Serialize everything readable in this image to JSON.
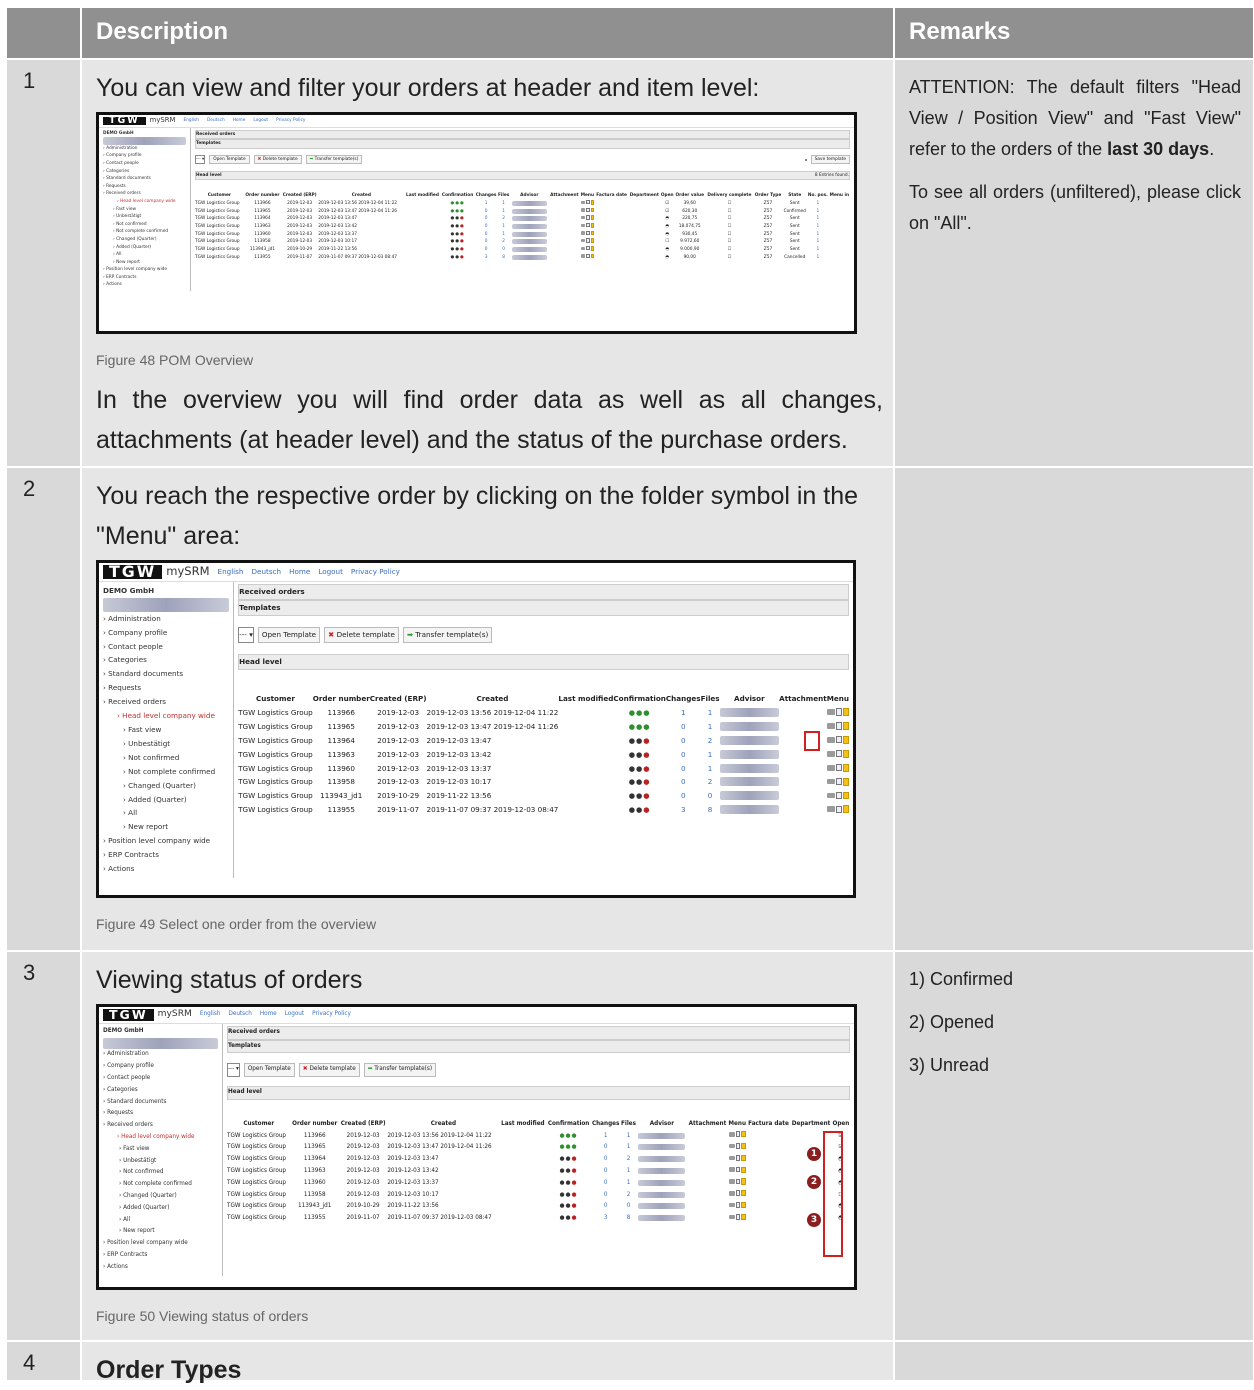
{
  "header": {
    "description": "Description",
    "remarks": "Remarks"
  },
  "rows": [
    {
      "num": "1",
      "lead": "You can view and filter your orders at header and item level:",
      "caption": "Figure 48 POM Overview",
      "para": "In the overview you will find order data as well as all changes, attachments (at header level) and the status of the purchase orders.",
      "remarks": {
        "p1": "ATTENTION: The default filters \"Head View / Position View\" and \"Fast View\" refer to the orders of the ",
        "p1_bold": "last 30 days",
        "p1_end": ".",
        "p2": "To see all orders (unfiltered), please click on \"All\"."
      }
    },
    {
      "num": "2",
      "lead": "You reach the respective order by clicking on the folder symbol in the \"Menu\" area:",
      "caption": "Figure 49 Select one order from the overview"
    },
    {
      "num": "3",
      "lead": "Viewing status of orders",
      "caption": "Figure 50 Viewing status of orders",
      "remarks": [
        "1) Confirmed",
        "2) Opened",
        "3) Unread"
      ]
    },
    {
      "num": "4",
      "lead": "Order Types"
    }
  ],
  "app": {
    "logo": "TGW",
    "brand": "mySRM",
    "links": [
      "English",
      "Deutsch",
      "Home",
      "Logout",
      "Privacy Policy"
    ],
    "company": "DEMO GmbH",
    "nav": [
      "Administration",
      "Company profile",
      "Contact people",
      "Categories",
      "Standard documents",
      "Requests",
      "Received orders"
    ],
    "nav_active": "Head level company wide",
    "nav_sub": [
      "Fast view",
      "Unbestätigt",
      "Not confirmed",
      "Not complete confirmed",
      "Changed (Quarter)",
      "Added (Quarter)",
      "All",
      "New report"
    ],
    "nav_tail": [
      "Position level company wide",
      "ERP Contracts",
      "Actions"
    ],
    "panel_title": "Received orders",
    "templates_title": "Templates",
    "select_value": "---",
    "btn_open": "Open Template",
    "btn_delete": "Delete template",
    "btn_transfer": "Transfer template(s)",
    "btn_save": "Save template",
    "head_level": "Head level",
    "entries_found": "8 Entries found.",
    "columns": [
      "Customer",
      "Order number",
      "Created (ERP)",
      "Created",
      "Last modified",
      "Confirmation",
      "Changes",
      "Files",
      "Advisor",
      "Attachment",
      "Menu"
    ],
    "columns_extra": [
      "Factura date",
      "Department",
      "Open",
      "Order value",
      "Delivery complete",
      "Order Type",
      "State",
      "No. pos.",
      "Menu in"
    ],
    "orders": [
      {
        "customer": "TGW Logistics Group",
        "number": "113966",
        "erp": "2019-12-03",
        "created": "2019-12-03 13:56",
        "modified": "2019-12-04 11:22",
        "conf": "green",
        "changes": "1",
        "files": "1",
        "value": "39,60",
        "type": "Z57",
        "state": "Sent"
      },
      {
        "customer": "TGW Logistics Group",
        "number": "113965",
        "erp": "2019-12-03",
        "created": "2019-12-03 13:47",
        "modified": "2019-12-04 11:26",
        "conf": "green",
        "changes": "0",
        "files": "1",
        "value": "620,30",
        "type": "Z57",
        "state": "Confirmed"
      },
      {
        "customer": "TGW Logistics Group",
        "number": "113964",
        "erp": "2019-12-03",
        "created": "2019-12-03 13:47",
        "modified": "",
        "conf": "black",
        "changes": "0",
        "files": "2",
        "value": "220,75",
        "type": "Z57",
        "state": "Sent"
      },
      {
        "customer": "TGW Logistics Group",
        "number": "113963",
        "erp": "2019-12-03",
        "created": "2019-12-03 13:42",
        "modified": "",
        "conf": "black",
        "changes": "0",
        "files": "1",
        "value": "18.074,75",
        "type": "Z57",
        "state": "Sent"
      },
      {
        "customer": "TGW Logistics Group",
        "number": "113960",
        "erp": "2019-12-03",
        "created": "2019-12-03 13:37",
        "modified": "",
        "conf": "black",
        "changes": "0",
        "files": "1",
        "value": "930,45",
        "type": "Z57",
        "state": "Sent"
      },
      {
        "customer": "TGW Logistics Group",
        "number": "113958",
        "erp": "2019-12-03",
        "created": "2019-12-03 10:17",
        "modified": "",
        "conf": "black",
        "changes": "0",
        "files": "2",
        "value": "9.972,60",
        "type": "Z57",
        "state": "Sent"
      },
      {
        "customer": "TGW Logistics Group",
        "number": "113943_jd1",
        "erp": "2019-10-29",
        "created": "2019-11-22 13:56",
        "modified": "",
        "conf": "black",
        "changes": "0",
        "files": "0",
        "value": "9.000,90",
        "type": "Z57",
        "state": "Sent"
      },
      {
        "customer": "TGW Logistics Group",
        "number": "113955",
        "erp": "2019-11-07",
        "created": "2019-11-07 09:37",
        "modified": "2019-12-03 08:47",
        "conf": "black",
        "changes": "3",
        "files": "8",
        "value": "90,00",
        "type": "Z57",
        "state": "Cancelled"
      }
    ],
    "markers": [
      "1",
      "2",
      "3"
    ]
  }
}
